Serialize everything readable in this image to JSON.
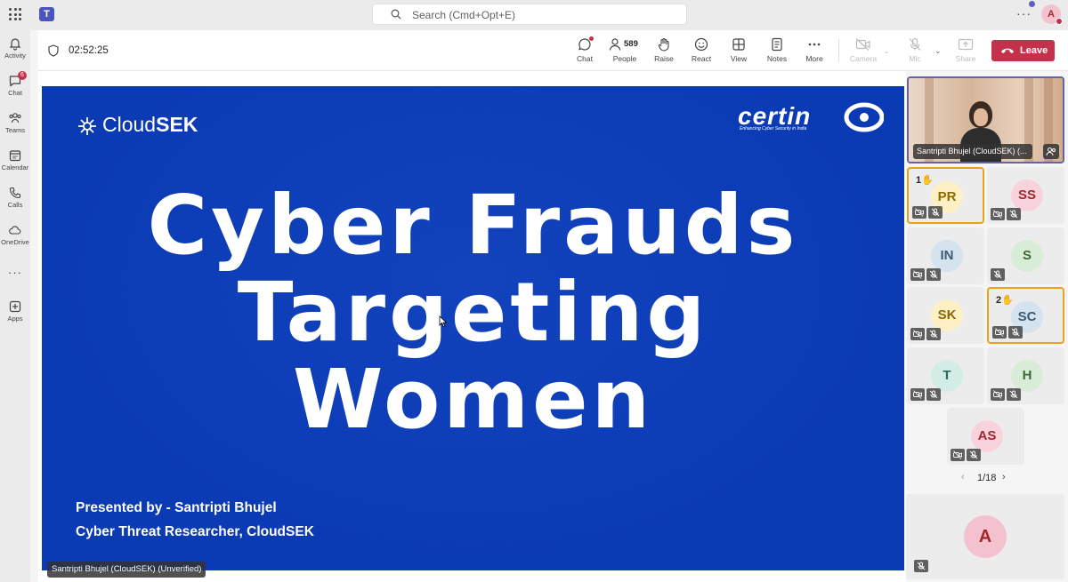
{
  "topbar": {
    "search_placeholder": "Search (Cmd+Opt+E)",
    "app_icon": "teams-logo",
    "user_initial": "A"
  },
  "rail": {
    "items": [
      {
        "label": "Activity",
        "icon": "bell-icon"
      },
      {
        "label": "Chat",
        "icon": "chat-icon",
        "badge": "6"
      },
      {
        "label": "Teams",
        "icon": "teams-icon"
      },
      {
        "label": "Calendar",
        "icon": "calendar-icon"
      },
      {
        "label": "Calls",
        "icon": "phone-icon"
      },
      {
        "label": "OneDrive",
        "icon": "cloud-icon"
      },
      {
        "label": "Apps",
        "icon": "plus-square-icon"
      }
    ]
  },
  "meeting": {
    "timer": "02:52:25",
    "toolbar": {
      "chat": "Chat",
      "people": "People",
      "people_count": "589",
      "raise": "Raise",
      "react": "React",
      "view": "View",
      "notes": "Notes",
      "more": "More",
      "camera": "Camera",
      "mic": "Mic",
      "share": "Share",
      "leave": "Leave"
    }
  },
  "slide": {
    "logo_left": {
      "prefix": "Cloud",
      "suffix": "SEK"
    },
    "logo_right": {
      "name": "certin",
      "tagline": "Enhancing Cyber Security in India"
    },
    "title_lines": [
      "Cyber Frauds",
      "Targeting",
      "Women"
    ],
    "presented_by": "Presented by - Santripti Bhujel",
    "role": "Cyber Threat Researcher, CloudSEK",
    "bg_color": "#0b3ab5"
  },
  "presenter_tag": "Santripti Bhujel (CloudSEK) (Unverified)",
  "video_tile": {
    "name": "Santripti Bhujel (CloudSEK) (..."
  },
  "participants": [
    {
      "initials": "PR",
      "bg": "#fdf0c4",
      "fg": "#8a6a00",
      "hand": "1"
    },
    {
      "initials": "SS",
      "bg": "#f9d3dc",
      "fg": "#a4262c"
    },
    {
      "initials": "IN",
      "bg": "#d5e3ee",
      "fg": "#3b5b73"
    },
    {
      "initials": "S",
      "bg": "#d9ecd8",
      "fg": "#3d6b38"
    },
    {
      "initials": "SK",
      "bg": "#fdf0c4",
      "fg": "#8a6a00"
    },
    {
      "initials": "SC",
      "bg": "#d5e3ee",
      "fg": "#3b5b73",
      "hand": "2"
    },
    {
      "initials": "T",
      "bg": "#d4ece6",
      "fg": "#2e6b5e"
    },
    {
      "initials": "H",
      "bg": "#d9ecd8",
      "fg": "#3d6b38"
    },
    {
      "initials": "AS",
      "bg": "#f9d3dc",
      "fg": "#a4262c"
    }
  ],
  "pager": {
    "text": "1/18"
  },
  "bottom_participant": {
    "initials": "A"
  }
}
